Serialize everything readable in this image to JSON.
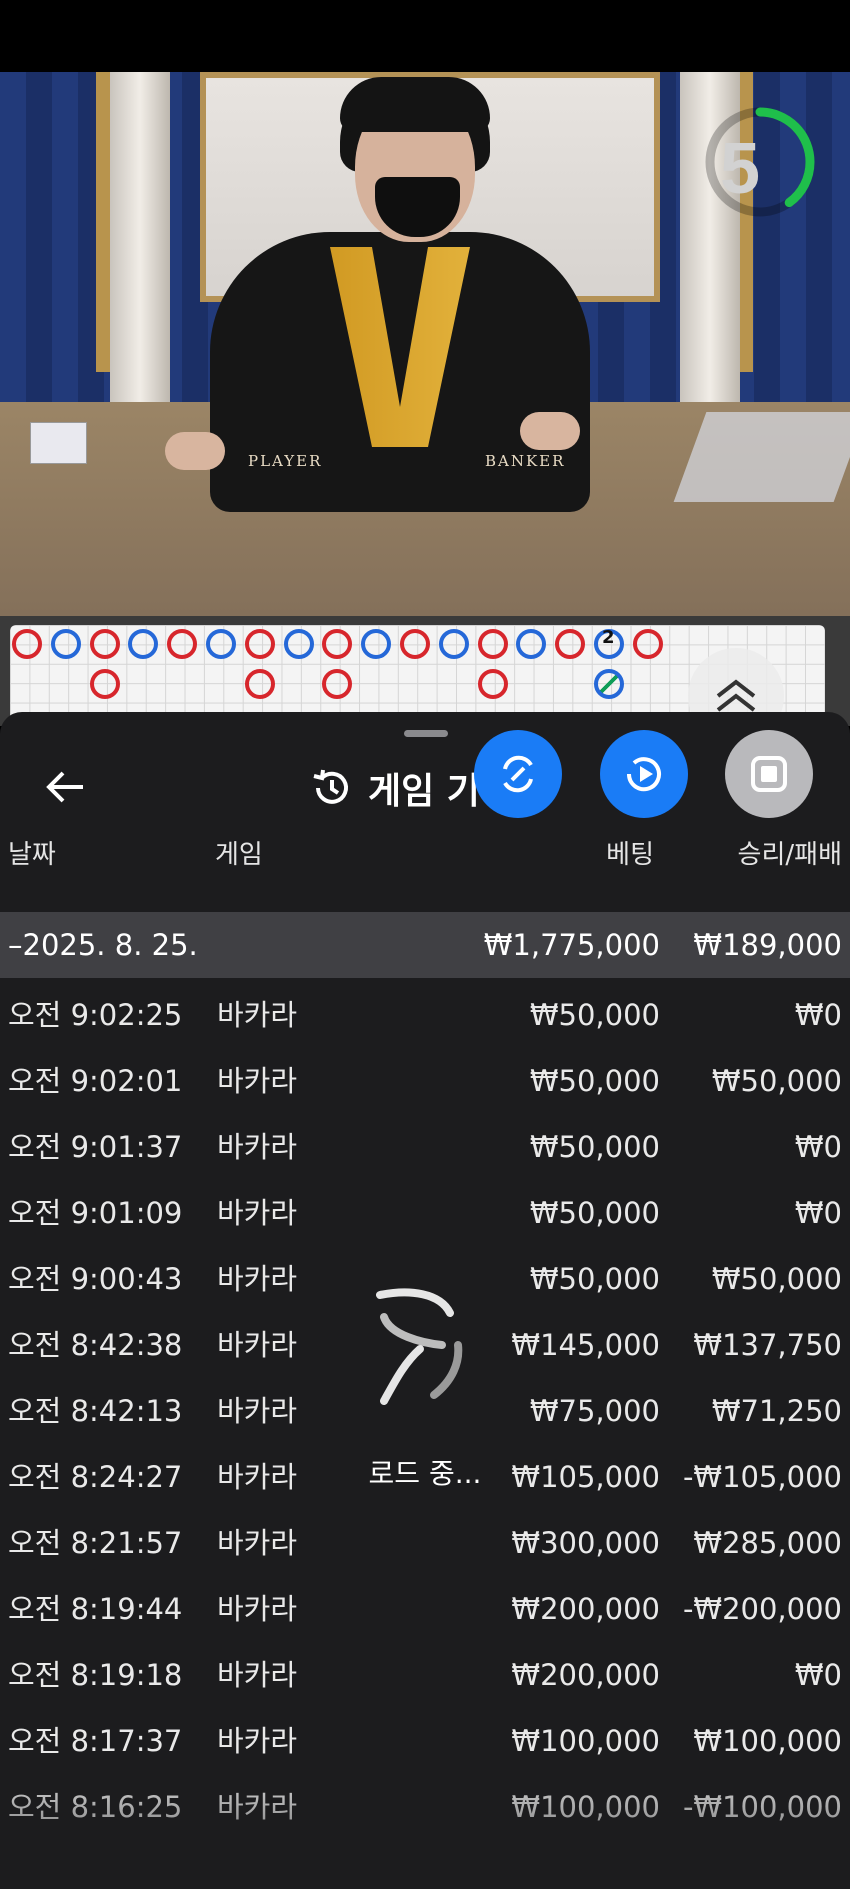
{
  "timer": {
    "count": "5",
    "progress": 0.4,
    "color": "#1fbf4b"
  },
  "video": {
    "player_label": "PLAYER",
    "banker_label": "BANKER"
  },
  "road": {
    "banker_color": "#d7262c",
    "player_color": "#2568d8",
    "tie_color": "#0f9d58",
    "tie_count": "2"
  },
  "sheet": {
    "title": "게임 기록",
    "columns": {
      "date": "날짜",
      "game": "게임",
      "bet": "베팅",
      "winloss": "승리/패배"
    },
    "summary": {
      "date": "–2025. 8. 25.",
      "bet": "₩1,775,000",
      "winloss": "₩189,000"
    },
    "rows": [
      {
        "time": "오전 9:02:25",
        "game": "바카라",
        "bet": "₩50,000",
        "winloss": "₩0"
      },
      {
        "time": "오전 9:02:01",
        "game": "바카라",
        "bet": "₩50,000",
        "winloss": "₩50,000"
      },
      {
        "time": "오전 9:01:37",
        "game": "바카라",
        "bet": "₩50,000",
        "winloss": "₩0"
      },
      {
        "time": "오전 9:01:09",
        "game": "바카라",
        "bet": "₩50,000",
        "winloss": "₩0"
      },
      {
        "time": "오전 9:00:43",
        "game": "바카라",
        "bet": "₩50,000",
        "winloss": "₩50,000"
      },
      {
        "time": "오전 8:42:38",
        "game": "바카라",
        "bet": "₩145,000",
        "winloss": "₩137,750"
      },
      {
        "time": "오전 8:42:13",
        "game": "바카라",
        "bet": "₩75,000",
        "winloss": "₩71,250"
      },
      {
        "time": "오전 8:24:27",
        "game": "바카라",
        "bet": "₩105,000",
        "winloss": "-₩105,000"
      },
      {
        "time": "오전 8:21:57",
        "game": "바카라",
        "bet": "₩300,000",
        "winloss": "₩285,000"
      },
      {
        "time": "오전 8:19:44",
        "game": "바카라",
        "bet": "₩200,000",
        "winloss": "-₩200,000"
      },
      {
        "time": "오전 8:19:18",
        "game": "바카라",
        "bet": "₩200,000",
        "winloss": "₩0"
      },
      {
        "time": "오전 8:17:37",
        "game": "바카라",
        "bet": "₩100,000",
        "winloss": "₩100,000"
      },
      {
        "time": "오전 8:16:25",
        "game": "바카라",
        "bet": "₩100,000",
        "winloss": "-₩100,000"
      }
    ],
    "loading_text": "로드 중..."
  }
}
